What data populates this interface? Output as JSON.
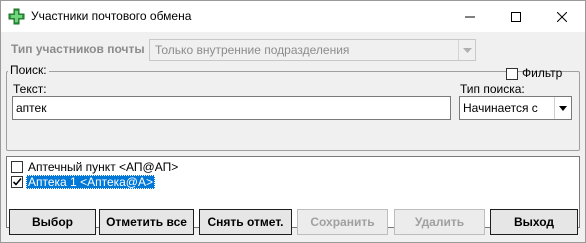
{
  "window": {
    "title": "Участники почтового обмена",
    "icon": "green-cross-icon",
    "controls": [
      "minimize-icon",
      "maximize-icon",
      "close-icon"
    ]
  },
  "participants_type": {
    "label": "Тип участников почты",
    "value": "Только внутренние подразделения",
    "enabled": false
  },
  "search": {
    "legend": "Поиск:",
    "filter_label": "Фильтр",
    "filter_checked": false,
    "text_label": "Текст:",
    "text_value": "аптек",
    "search_type_label": "Тип поиска:",
    "search_type_value": "Начинается с"
  },
  "list": {
    "items": [
      {
        "label": "Аптечный пункт  <АП@АП>",
        "checked": false,
        "selected": false
      },
      {
        "label": "Аптека 1 <Аптека@А>",
        "checked": true,
        "selected": true
      }
    ]
  },
  "buttons": {
    "choose": "Выбор",
    "mark_all": "Отметить все",
    "unmark": "Снять отмет.",
    "save": "Сохранить",
    "delete": "Удалить",
    "exit": "Выход"
  },
  "colors": {
    "selection": "#0078d7",
    "window_bg": "#f0f0f0",
    "disabled_text": "#a0a0a0",
    "icon_green": "#2e9e3e"
  }
}
